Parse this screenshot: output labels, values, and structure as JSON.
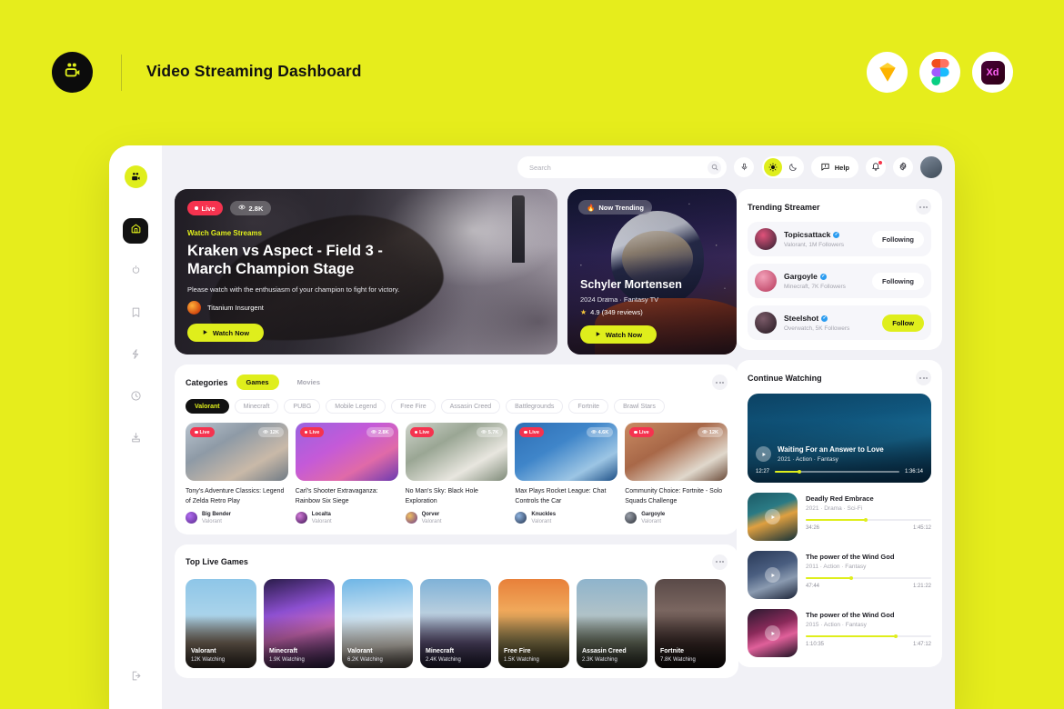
{
  "page": {
    "title": "Video Streaming Dashboard",
    "logo_icon": "video-camera-icon",
    "tools": [
      {
        "name": "sketch-icon",
        "label": "Sketch"
      },
      {
        "name": "figma-icon",
        "label": "Figma"
      },
      {
        "name": "adobe-xd-icon",
        "label": "Xd"
      }
    ]
  },
  "colors": {
    "background": "#E6ED1C",
    "accent": "#DFEE1C",
    "live": "#F5334F",
    "panel": "#F1F1F6",
    "card": "#FFFFFF",
    "verified": "#2B9CF0"
  },
  "sidebar": {
    "logo_icon": "video-camera-icon",
    "items": [
      {
        "name": "home",
        "icon": "home-icon",
        "active": true
      },
      {
        "name": "trending",
        "icon": "flame-icon",
        "active": false
      },
      {
        "name": "bookmarks",
        "icon": "bookmark-icon",
        "active": false
      },
      {
        "name": "highlights",
        "icon": "lightning-icon",
        "active": false
      },
      {
        "name": "history",
        "icon": "clock-icon",
        "active": false
      },
      {
        "name": "downloads",
        "icon": "download-icon",
        "active": false
      }
    ],
    "logout": {
      "name": "logout",
      "icon": "logout-icon"
    }
  },
  "topbar": {
    "search": {
      "value": "",
      "placeholder": "Search",
      "icon": "search-icon"
    },
    "mic_icon": "microphone-icon",
    "theme": {
      "light_icon": "sun-icon",
      "dark_icon": "moon-icon",
      "active": "light"
    },
    "help": {
      "label": "Help",
      "icon": "chat-help-icon"
    },
    "notifications": {
      "icon": "bell-icon",
      "has_unread": true
    },
    "settings_icon": "gear-icon",
    "avatar": "user-avatar"
  },
  "hero": {
    "main": {
      "live_label": "Live",
      "views": "2.8K",
      "eyebrow": "Watch Game Streams",
      "title": "Kraken vs Aspect - Field 3 - March Champion Stage",
      "description": "Please watch with the enthusiasm of your champion to fight for victory.",
      "author": "Titanium Insurgent",
      "cta": "Watch Now"
    },
    "side": {
      "badge": "Now Trending",
      "title": "Schyler Mortensen",
      "meta": "2024   Drama  ·  Fantasy TV",
      "rating": "4.9 (349 reviews)",
      "cta": "Watch Now"
    }
  },
  "trending_streamer": {
    "title": "Trending Streamer",
    "streamers": [
      {
        "name": "Topicsattack",
        "verified": true,
        "sub": "Valorant, 1M Followers",
        "action": "Following",
        "primary": false,
        "avatar_colors": [
          "#e0527a",
          "#2b2030"
        ]
      },
      {
        "name": "Gargoyle",
        "verified": true,
        "sub": "Minecraft, 7K Followers",
        "action": "Following",
        "primary": false,
        "avatar_colors": [
          "#f2a0b8",
          "#b6375a"
        ]
      },
      {
        "name": "Steelshot",
        "verified": true,
        "sub": "Overwatch, 5K Followers",
        "action": "Follow",
        "primary": true,
        "avatar_colors": [
          "#7a5a68",
          "#241820"
        ]
      }
    ]
  },
  "categories": {
    "label": "Categories",
    "tabs": [
      {
        "label": "Games",
        "active": true
      },
      {
        "label": "Movies",
        "active": false
      }
    ],
    "chips": [
      {
        "label": "Valorant",
        "active": true
      },
      {
        "label": "Minecraft",
        "active": false
      },
      {
        "label": "PUBG",
        "active": false
      },
      {
        "label": "Mobile Legend",
        "active": false
      },
      {
        "label": "Free Fire",
        "active": false
      },
      {
        "label": "Assasin Creed",
        "active": false
      },
      {
        "label": "Battlegrounds",
        "active": false
      },
      {
        "label": "Fortnite",
        "active": false
      },
      {
        "label": "Brawl Stars",
        "active": false
      }
    ],
    "videos": [
      {
        "live": "Live",
        "views": "12K",
        "title": "Tony's Adventure Classics: Legend of Zelda Retro Play",
        "author": "Big Bender",
        "game": "Valorant",
        "thumb": "linear-gradient(150deg,#b9c4cf 0%,#8e9aa6 35%,#c9b9a8 70%,#6f7a85 100%)",
        "ava": "radial-gradient(circle at 35% 35%,#b06cf0,#5a2a8c)"
      },
      {
        "live": "Live",
        "views": "2.8K",
        "title": "Carl's Shooter Extravaganza: Rainbow Six Siege",
        "author": "Localta",
        "game": "Valorant",
        "thumb": "linear-gradient(150deg,#9a63e0 0%,#c45ad8 40%,#e06aa8 70%,#6b3ab0 100%)",
        "ava": "radial-gradient(circle at 35% 35%,#d27ad8,#3a1250)"
      },
      {
        "live": "Live",
        "views": "5.7K",
        "title": "No Man's Sky: Black Hole Exploration",
        "author": "Qorver",
        "game": "Valorant",
        "thumb": "linear-gradient(150deg,#cfd4cb 0%,#9aa694 35%,#e8e6df 70%,#7e8a78 100%)",
        "ava": "radial-gradient(circle at 35% 35%,#f0c060,#6a3a8c)"
      },
      {
        "live": "Live",
        "views": "4.6K",
        "title": "Max Plays Rocket League: Chat Controls the Car",
        "author": "Knuckles",
        "game": "Valorant",
        "thumb": "linear-gradient(150deg,#2e6fb5 0%,#3f85c9 40%,#9cc5e4 75%,#1d4f86 100%)",
        "ava": "radial-gradient(circle at 35% 35%,#8fb4e0,#22304a)"
      },
      {
        "live": "Live",
        "views": "12K",
        "title": "Community Choice: Fortnite - Solo Squads Challenge",
        "author": "Gargoyle",
        "game": "Valorant",
        "thumb": "linear-gradient(150deg,#c98a62 0%,#a86848 40%,#e0d8cc 75%,#6a4a38 100%)",
        "ava": "radial-gradient(circle at 35% 35%,#9aa0aa,#2a2e36)"
      }
    ]
  },
  "top_live_games": {
    "title": "Top Live Games",
    "prev_icon": "chevron-left-icon",
    "next_icon": "chevron-right-icon",
    "games": [
      {
        "name": "Valorant",
        "watching": "12K Watching",
        "thumb": "linear-gradient(180deg,#8ec6e8 0%,#a9d3ea 40%,#7a6b5c 72%,#4a3f36 100%)"
      },
      {
        "name": "Minecraft",
        "watching": "1.9K Watching",
        "thumb": "linear-gradient(165deg,#2a1c4a 0%,#8c4fd0 35%,#d06ab8 60%,#3a2a5c 100%)"
      },
      {
        "name": "Valorant",
        "watching": "6.2K Watching",
        "thumb": "linear-gradient(175deg,#6fb6e6 0%,#cfe4f2 45%,#d8d2c8 75%,#6a6056 100%)"
      },
      {
        "name": "Minecraft",
        "watching": "2.4K Watching",
        "thumb": "linear-gradient(180deg,#7fb2d8 0%,#b8cede 38%,#5a4e72 72%,#2e2844 100%)"
      },
      {
        "name": "Free Fire",
        "watching": "1.5K Watching",
        "thumb": "linear-gradient(180deg,#e8803a 0%,#f0a85a 35%,#8a7a4a 70%,#4a4428 100%)"
      },
      {
        "name": "Assasin Creed",
        "watching": "2.3K Watching",
        "thumb": "linear-gradient(180deg,#8fb4cc 0%,#b0c2c8 40%,#6a7260 72%,#3a3c32 100%)"
      },
      {
        "name": "Fortnite",
        "watching": "7.8K Watching",
        "thumb": "linear-gradient(180deg,#5a4a48 0%,#7a6660 35%,#3a2a28 72%,#1a1210 100%)"
      }
    ]
  },
  "continue_watching": {
    "title": "Continue Watching",
    "featured": {
      "title": "Waiting For an Answer to Love",
      "meta": "2021  ·  Action  ·  Fantasy",
      "elapsed": "12:27",
      "duration": "1:36:14",
      "progress": 20,
      "play_icon": "play-icon"
    },
    "items": [
      {
        "title": "Deadly Red Embrace",
        "meta": "2021  ·  Drama  ·  Sci-Fi",
        "elapsed": "34:26",
        "duration": "1:45:12",
        "progress": 48,
        "play_icon": "play-icon",
        "thumb": "linear-gradient(160deg,#1d5a66 0%,#2a7a84 35%,#e0a040 55%,#123038 100%)"
      },
      {
        "title": "The power of the Wind God",
        "meta": "2011  ·  Action  ·  Fantasy",
        "elapsed": "47:44",
        "duration": "1:21:22",
        "progress": 36,
        "play_icon": "play-icon",
        "thumb": "linear-gradient(160deg,#2a3a58 0%,#4a5e80 40%,#8a9ab0 65%,#1a2236 100%)"
      },
      {
        "title": "The power of the Wind God",
        "meta": "2015  ·  Action  ·  Fantasy",
        "elapsed": "1:10:35",
        "duration": "1:47:12",
        "progress": 72,
        "play_icon": "play-icon",
        "thumb": "linear-gradient(160deg,#2a1a30 0%,#8a2a5a 40%,#e0609a 62%,#1a1020 100%)"
      }
    ]
  }
}
